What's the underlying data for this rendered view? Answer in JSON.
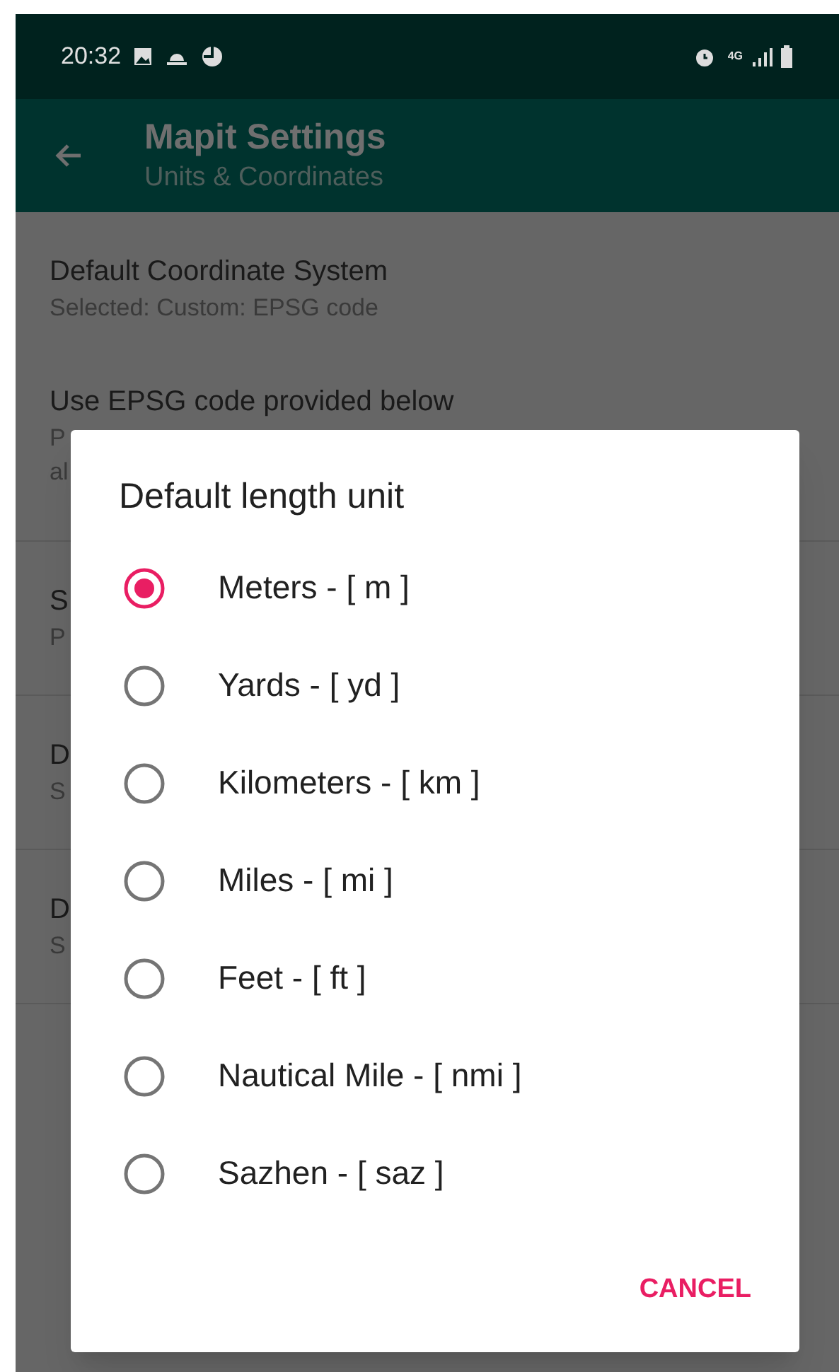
{
  "status_bar": {
    "time": "20:32",
    "network": "4G"
  },
  "app_bar": {
    "title": "Mapit Settings",
    "subtitle": "Units & Coordinates"
  },
  "settings": [
    {
      "title": "Default Coordinate System",
      "summary": [
        "Selected: Custom: EPSG code"
      ],
      "divider": false
    },
    {
      "title": "Use EPSG code provided below",
      "summary": [
        "P",
        "al"
      ],
      "divider": false
    },
    {
      "title": "S",
      "summary": [
        "P"
      ],
      "divider": true
    },
    {
      "title": "D",
      "summary": [
        "S"
      ],
      "divider": true
    },
    {
      "title": "D",
      "summary": [
        "S"
      ],
      "divider": true
    }
  ],
  "dialog": {
    "title": "Default length unit",
    "options": [
      {
        "label": "Meters - [ m ]",
        "selected": true
      },
      {
        "label": "Yards - [ yd ]",
        "selected": false
      },
      {
        "label": "Kilometers - [ km ]",
        "selected": false
      },
      {
        "label": "Miles - [ mi ]",
        "selected": false
      },
      {
        "label": "Feet - [ ft ]",
        "selected": false
      },
      {
        "label": "Nautical Mile - [ nmi ]",
        "selected": false
      },
      {
        "label": "Sazhen - [ saz ]",
        "selected": false
      }
    ],
    "button": "CANCEL"
  }
}
